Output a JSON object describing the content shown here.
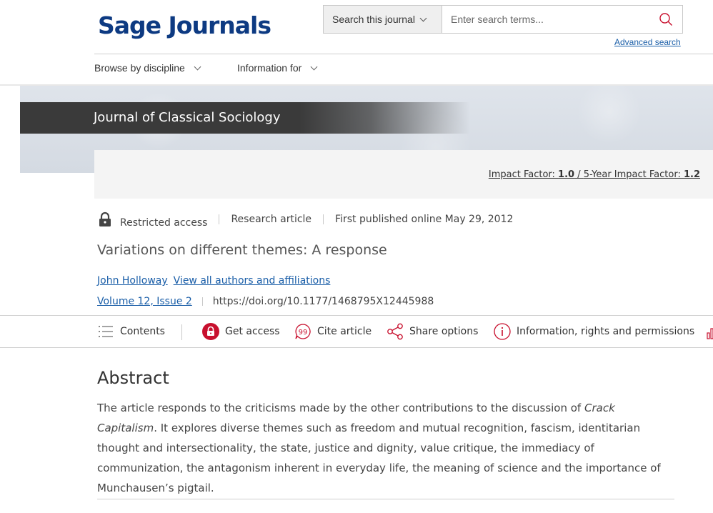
{
  "header": {
    "logo": "Sage Journals",
    "search_scope": "Search this journal",
    "search_placeholder": "Enter search terms...",
    "advanced_search": "Advanced search"
  },
  "nav": {
    "items": [
      {
        "label": "Browse by discipline"
      },
      {
        "label": "Information for"
      }
    ]
  },
  "journal": {
    "title": "Journal of Classical Sociology",
    "impact_label": "Impact Factor: ",
    "impact_value": "1.0",
    "impact_sep": " / ",
    "five_year_label": "5-Year Impact Factor: ",
    "five_year_value": "1.2"
  },
  "article": {
    "access": "Restricted access",
    "type": "Research article",
    "published": "First published online May 29, 2012",
    "title": "Variations on different themes: A response",
    "author": "John Holloway",
    "all_authors": "View all authors and affiliations",
    "volume": "Volume 12, Issue 2",
    "doi": "https://doi.org/10.1177/1468795X12445988"
  },
  "toolbar": {
    "contents": "Contents",
    "get_access": "Get access",
    "cite": "Cite article",
    "share": "Share options",
    "info": "Information, rights and permissions"
  },
  "abstract": {
    "heading": "Abstract",
    "text_before": "The article responds to the criticisms made by the other contributions to the discussion of ",
    "text_em": "Crack Capitalism",
    "text_after": ". It explores diverse themes such as freedom and mutual recognition, fascism, identitarian thought and intersectionality, the state, justice and dignity, value critique, the immediacy of communization, the antagonism inherent in everyday life, the meaning of science and the importance of Munchausen’s pigtail."
  },
  "colors": {
    "brand": "#0d3a82",
    "link": "#1a5ea8",
    "accent_red": "#c8102e",
    "banner_band": "#3a3a3a"
  }
}
